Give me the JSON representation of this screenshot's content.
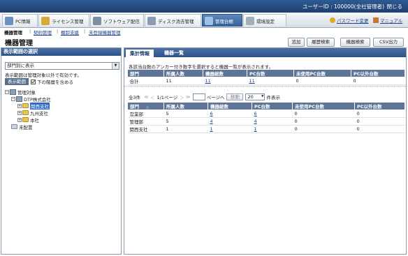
{
  "topbar": {
    "user_label": "ユーザーID : 100000(全社管理者)",
    "close_label": "閉じる"
  },
  "nav": {
    "tabs": [
      {
        "label": "PC情報",
        "icon": "pc-icon",
        "color": "#6d8fbf"
      },
      {
        "label": "ライセンス管理",
        "icon": "license-icon",
        "color": "#d9a83a"
      },
      {
        "label": "ソフトウェア配信",
        "icon": "software-icon",
        "color": "#7f8fa3"
      },
      {
        "label": "ディスク消去管理",
        "icon": "disk-icon",
        "color": "#8a9cb2"
      },
      {
        "label": "管理台帳",
        "icon": "ledger-icon",
        "color": "#9fbfe8"
      },
      {
        "label": "環境設定",
        "icon": "settings-icon",
        "color": "#a3afbd"
      }
    ],
    "active_index": 4,
    "password_link": "パスワード変更",
    "manual_link": "マニュアル"
  },
  "subnav": {
    "current": "機器管理",
    "links": [
      "契約管理",
      "棚卸支援",
      "未登録機器管理"
    ]
  },
  "page_title": "機器管理",
  "toolbar": {
    "add": "追加",
    "history_search": "履歴検索",
    "device_search": "機器検索",
    "csv": "CSV出力"
  },
  "left": {
    "header": "表示範囲の選択",
    "select_value": "部門別に表示",
    "note": "表示範囲は管理対象以外で有効です。",
    "range_label": "表示範囲",
    "include_lower_label": "下の階層を含める",
    "tree": {
      "root": "管理対象",
      "company": "DTP株式会社",
      "items": [
        "関西支社",
        "九州支社",
        "本社"
      ],
      "unassigned": "未配置"
    }
  },
  "right": {
    "tabs": [
      "集計情報",
      "機器一覧"
    ],
    "description": "各該当台数のアンカー付き数字を選択すると機器一覧が表示されます。",
    "summary": {
      "headers": [
        "部門",
        "所属人数",
        "機器総数",
        "PC台数",
        "未使用PC台数",
        "PC以外台数"
      ],
      "row": [
        "合計",
        "11",
        "11",
        "11",
        "0",
        "0"
      ]
    },
    "pager": {
      "count": "全3件",
      "page_info": "1/1ページ",
      "page_suffix": "ページへ",
      "go_label": "移動",
      "page_size": "20",
      "size_suffix": "件表示",
      "first": "≪",
      "prev": "＜",
      "next": "＞",
      "last": "≫"
    },
    "list": {
      "headers": [
        "部門",
        "所属人数",
        "機器総数",
        "PC台数",
        "未使用PC台数",
        "PC以外台数"
      ],
      "rows": [
        [
          "営業部",
          "5",
          "6",
          "6",
          "0",
          "0"
        ],
        [
          "管理部",
          "5",
          "4",
          "4",
          "0",
          "0"
        ],
        [
          "関西支社",
          "1",
          "1",
          "1",
          "0",
          "0"
        ]
      ]
    }
  }
}
